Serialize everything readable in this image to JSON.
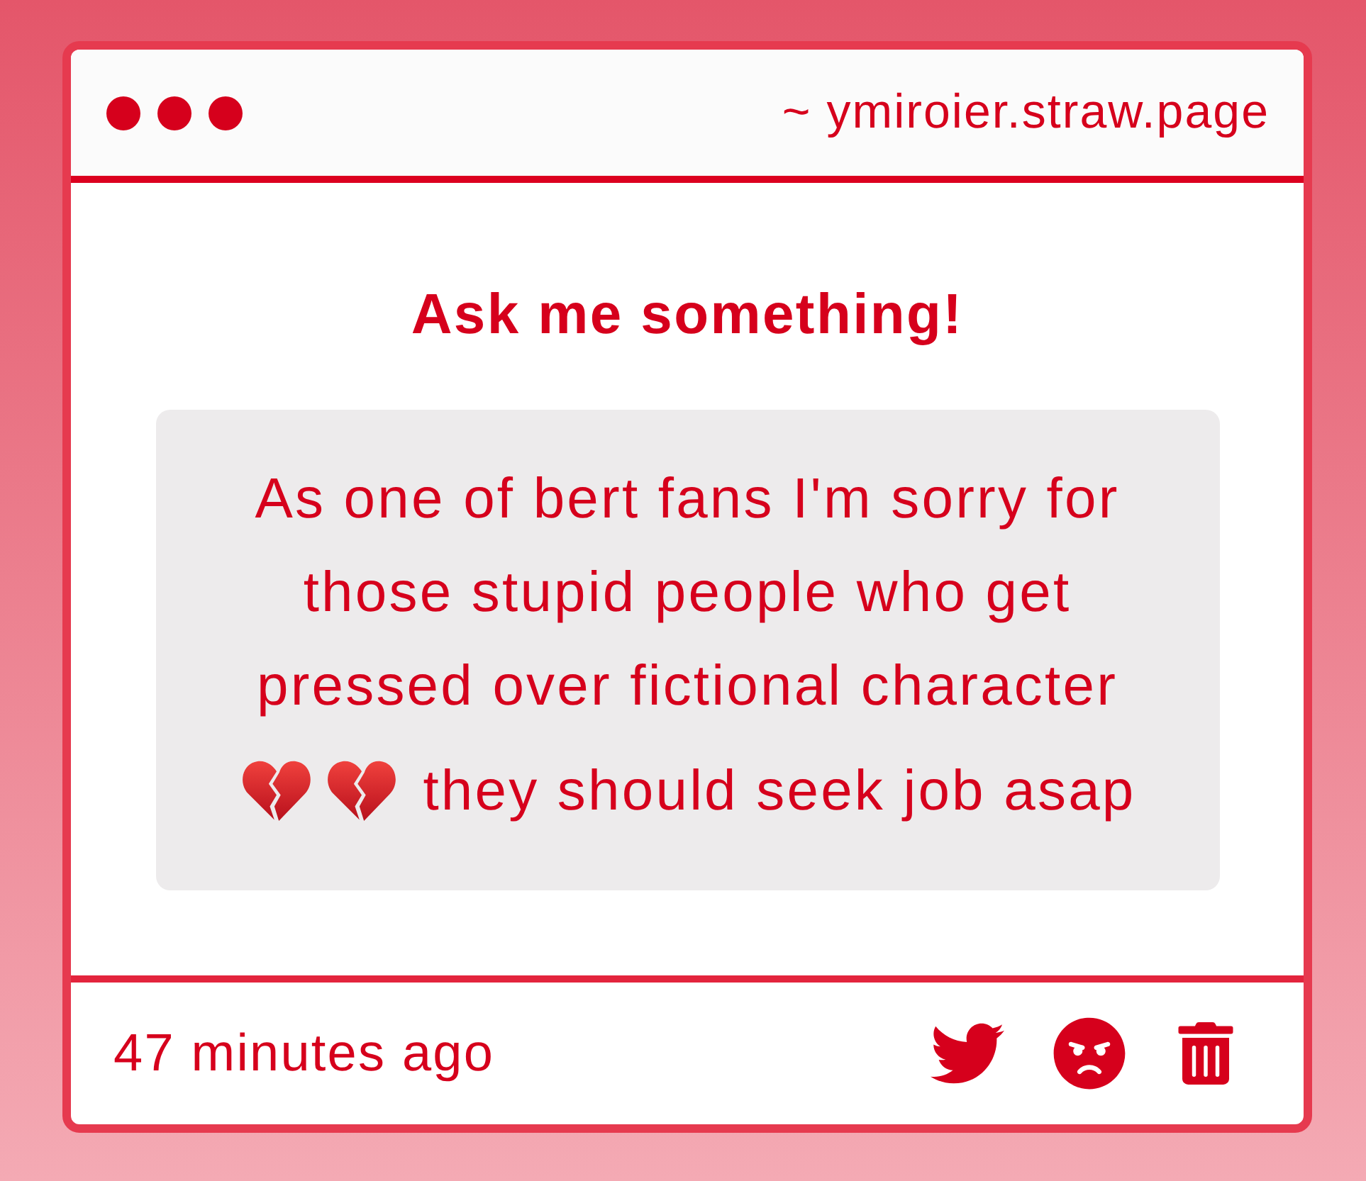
{
  "window": {
    "url": "~ ymiroier.straw.page"
  },
  "heading": "Ask me something!",
  "message": {
    "text": "As one of bert fans I'm sorry for those stupid people who get pressed over fictional character",
    "last_line": "they should seek job asap"
  },
  "footer": {
    "time": "47 minutes ago"
  }
}
